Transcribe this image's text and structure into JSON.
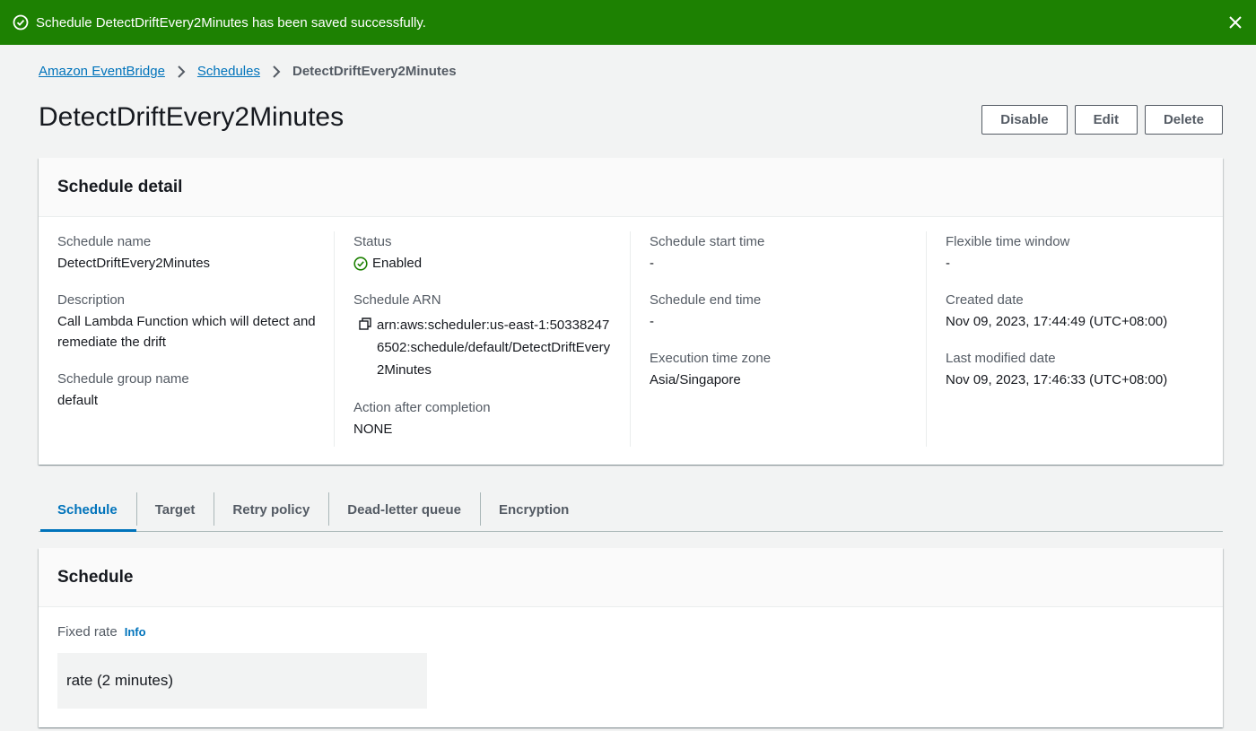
{
  "flash": {
    "message": "Schedule DetectDriftEvery2Minutes has been saved successfully.",
    "color": "#1d8102",
    "icon": "check-circle-icon",
    "close_icon": "close-icon"
  },
  "breadcrumb": {
    "items": [
      "Amazon EventBridge",
      "Schedules"
    ],
    "current": "DetectDriftEvery2Minutes"
  },
  "page": {
    "title": "DetectDriftEvery2Minutes"
  },
  "actions": {
    "disable": "Disable",
    "edit": "Edit",
    "delete": "Delete"
  },
  "detail": {
    "header": "Schedule detail",
    "schedule_name_label": "Schedule name",
    "schedule_name": "DetectDriftEvery2Minutes",
    "description_label": "Description",
    "description": "Call Lambda Function which will detect and remediate the drift",
    "group_label": "Schedule group name",
    "group": "default",
    "status_label": "Status",
    "status": "Enabled",
    "status_color": "#1d8102",
    "arn_label": "Schedule ARN",
    "arn": "arn:aws:scheduler:us-east-1:503382476502:schedule/default/DetectDriftEvery2Minutes",
    "action_label": "Action after completion",
    "action": "NONE",
    "start_label": "Schedule start time",
    "start": "-",
    "end_label": "Schedule end time",
    "end": "-",
    "tz_label": "Execution time zone",
    "tz": "Asia/Singapore",
    "flex_label": "Flexible time window",
    "flex": "-",
    "created_label": "Created date",
    "created": "Nov 09, 2023, 17:44:49 (UTC+08:00)",
    "modified_label": "Last modified date",
    "modified": "Nov 09, 2023, 17:46:33 (UTC+08:00)"
  },
  "tabs": [
    "Schedule",
    "Target",
    "Retry policy",
    "Dead-letter queue",
    "Encryption"
  ],
  "active_tab": "Schedule",
  "schedule": {
    "header": "Schedule",
    "fixed_rate_label": "Fixed rate",
    "info": "Info",
    "rate": "rate (2 minutes)"
  },
  "colors": {
    "link": "#0073bb",
    "success": "#1d8102"
  }
}
